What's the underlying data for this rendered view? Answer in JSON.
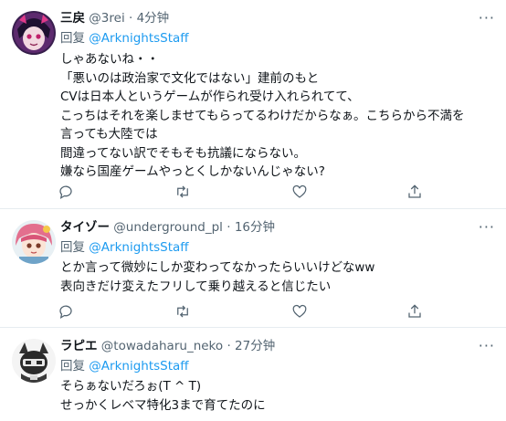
{
  "tweets": [
    {
      "name": "三戻",
      "handle": "@3rei",
      "separator": "·",
      "time": "4分钟",
      "reply_prefix": "回复",
      "reply_to": "@ArknightsStaff",
      "lines": [
        "しゃあないね・・",
        "「悪いのは政治家で文化ではない」建前のもと",
        "CVは日本人というゲームが作られ受け入れられてて、",
        "こっちはそれを楽しませてもらってるわけだからなぁ。こちらから不満を",
        "言っても大陸では",
        "間違ってない訳でそもそも抗議にならない。",
        "嫌なら国産ゲームやっとくしかないんじゃない?"
      ],
      "more_icon": "more-dots-icon"
    },
    {
      "name": "タイゾー",
      "handle": "@underground_pl",
      "separator": "·",
      "time": "16分钟",
      "reply_prefix": "回复",
      "reply_to": "@ArknightsStaff",
      "lines": [
        "とか言って微妙にしか変わってなかったらいいけどなww",
        "表向きだけ変えたフリして乗り越えると信じたい"
      ],
      "more_icon": "more-dots-icon"
    },
    {
      "name": "ラピエ",
      "handle": "@towadaharu_neko",
      "separator": "·",
      "time": "27分钟",
      "reply_prefix": "回复",
      "reply_to": "@ArknightsStaff",
      "lines": [
        "そらぁないだろぉ(T ^ T)",
        "せっかくレベマ特化3まで育てたのに"
      ],
      "more_icon": "more-dots-icon"
    }
  ],
  "actions": [
    "reply-icon",
    "retweet-icon",
    "like-icon",
    "share-icon"
  ],
  "colors": {
    "text": "#0f1419",
    "secondary": "#536471",
    "mention": "#1d9bf0",
    "divider": "#e6ecf0"
  }
}
